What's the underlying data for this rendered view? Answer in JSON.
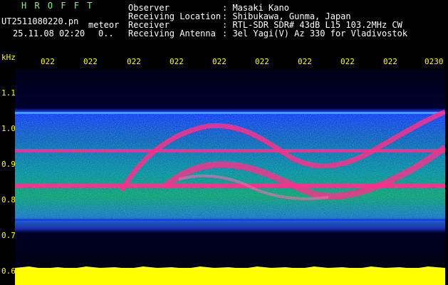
{
  "header": {
    "program": "H R O F F T",
    "filename": "UT2511080220.pn",
    "mode": "meteor",
    "datetime": "25.11.08 02:20",
    "counter": "0..",
    "fields": [
      {
        "label": "Observer",
        "value": ": Masaki Kano"
      },
      {
        "label": "Receiving Location",
        "value": ": Shibukawa, Gunma, Japan"
      },
      {
        "label": "Receiver",
        "value": ": RTL-SDR SDR# 43dB L15 103.2MHz CW"
      },
      {
        "label": "Receiving Antenna",
        "value": ": 3el Yagi(V) Az 330 for Vladivostok"
      }
    ]
  },
  "axis": {
    "unit": "kHz",
    "freq_labels": [
      "1.1",
      "1.0",
      "0.9",
      "0.8",
      "0.7",
      "0.6"
    ],
    "time_labels": [
      "022",
      "022",
      "022",
      "022",
      "022",
      "022",
      "022",
      "022",
      "022",
      "0230"
    ]
  },
  "colors": {
    "label": "#ffff00",
    "header_text": "#ffffff",
    "program": "#7CFC7C",
    "signal": "#ff2e8a",
    "noise": "#1a3cff"
  }
}
